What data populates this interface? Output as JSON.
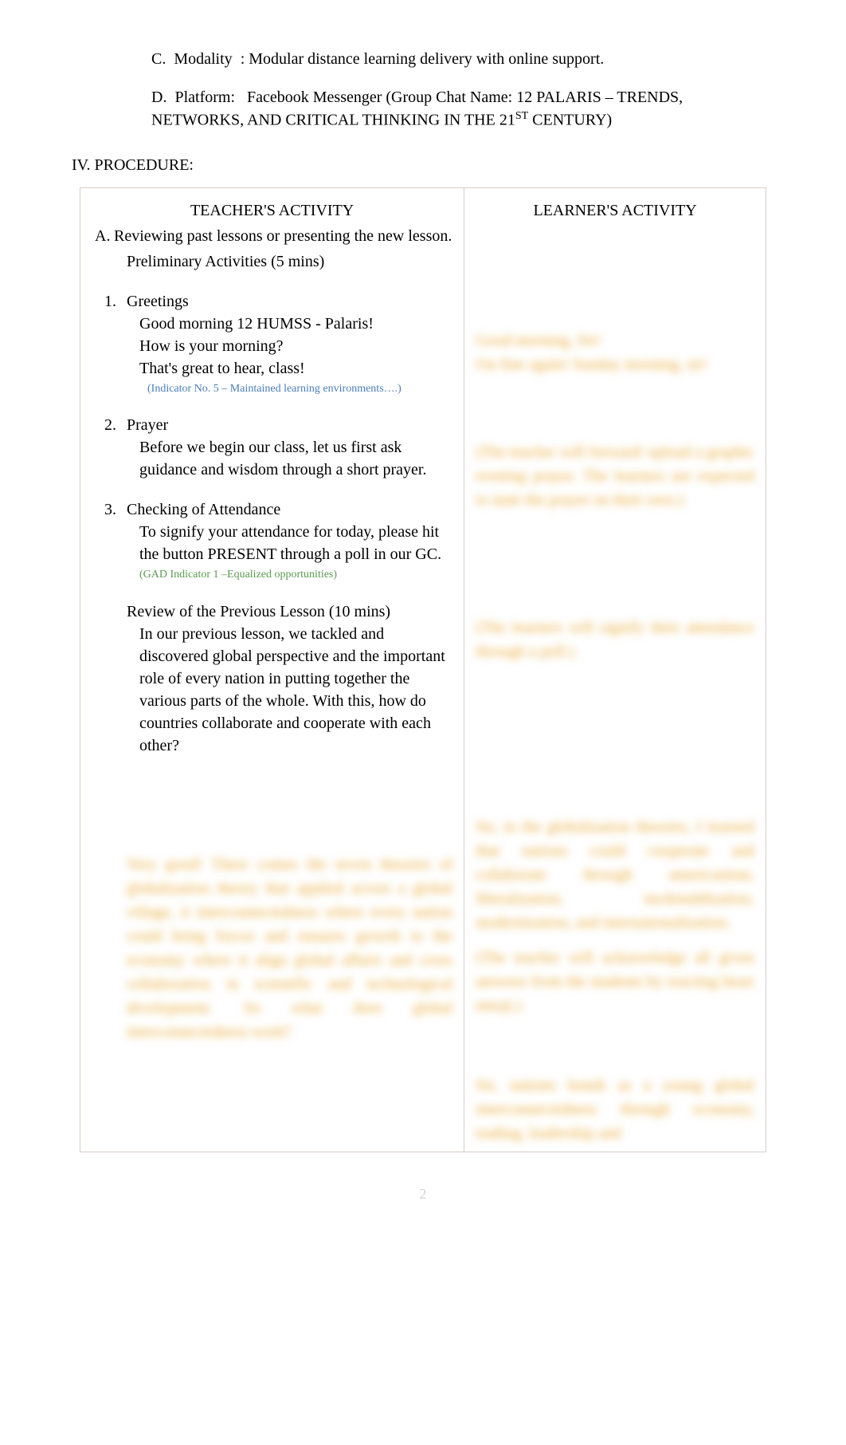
{
  "outline": {
    "c": {
      "marker": "C.",
      "label": "Modality",
      "value": ": Modular distance learning delivery with online support."
    },
    "d": {
      "marker": "D.",
      "label": "Platform:",
      "value": "Facebook Messenger (Group Chat Name: 12 PALARIS – TRENDS, NETWORKS, AND CRITICAL THINKING IN THE 21",
      "sup": "ST",
      "value_after": " CENTURY)"
    }
  },
  "section_heading": "IV. PROCEDURE:",
  "headers": {
    "teacher": "TEACHER'S ACTIVITY",
    "learner": "LEARNER'S ACTIVITY"
  },
  "teacher": {
    "a_marker": "A.",
    "a_text": "Reviewing past lessons or presenting the new lesson.",
    "prelim_marker": "",
    "prelim_text": "Preliminary Activities (5 mins)",
    "items": [
      {
        "num": "1.",
        "title": "Greetings",
        "lines": [
          "Good morning 12 HUMSS - Palaris!",
          "How is your morning?",
          "That's great to hear, class!"
        ],
        "indicator": "(Indicator No. 5 – Maintained learning environments….)"
      },
      {
        "num": "2.",
        "title": "Prayer",
        "lines": [
          "Before we begin our class, let us first ask guidance and wisdom through a short prayer."
        ]
      },
      {
        "num": "3.",
        "title": "Checking of Attendance",
        "lines": [
          "To signify your attendance for today, please hit the button PRESENT through a poll in our GC."
        ],
        "indicator_green": "(GAD Indicator 1 –Equalized opportunities)"
      }
    ],
    "review": {
      "marker": "",
      "title": "Review of the Previous Lesson (10 mins)",
      "body": "In our previous lesson, we tackled and discovered global perspective and the important role of every nation in putting together the various parts of the whole. With this, how do countries collaborate and cooperate with each other?"
    },
    "blurred_para": "Very good! There comes the seven theories of globalization theory that applied across a global village, it interconnectedness where every nation could bring forces and ensures growth to the economy where it align global affairs and cross collaboration in scientific and technological development. So what does global interconnectedness work?"
  },
  "learner": {
    "b1": "Good morning, Sir!\nI'm fine again! Sunday morning, sir!",
    "b2": "(The teacher will forward/ upload a graphic evening prayer. The learners are expected to state the prayer on their own.)",
    "b3": "(The learners will signify their attendance through a poll.)",
    "b4": "Sir, in the globalization theories, I learned that nations could cooperate and collaborate through americanism, liberalization, mcdonaldization, modernization, and internationalization.",
    "b5": "(The teacher will acknowledge all given answers from the students by reacting heart emoji.)",
    "b6": "Sir, nations bonds as a young global interconnectedness through economy, trading, leadership and"
  },
  "page_number": "2"
}
